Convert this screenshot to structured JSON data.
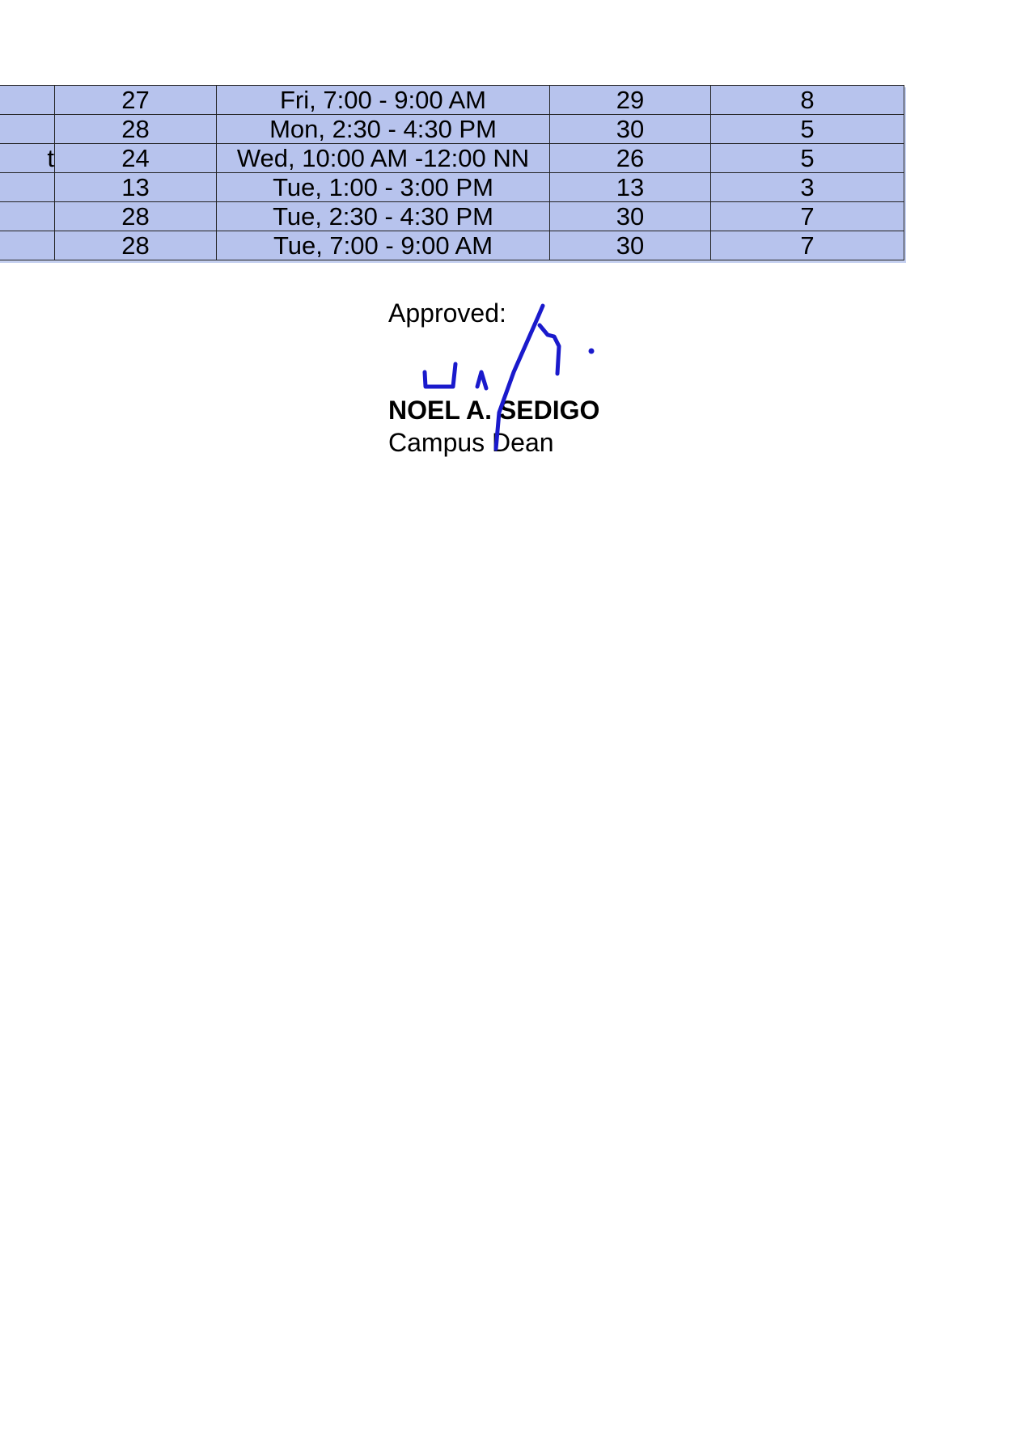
{
  "schedule": {
    "rows": [
      {
        "cells": [
          "",
          "27",
          "Fri, 7:00 - 9:00 AM",
          "29",
          "8"
        ]
      },
      {
        "cells": [
          "",
          "28",
          "Mon, 2:30 - 4:30 PM",
          "30",
          "5"
        ]
      },
      {
        "cells": [
          "t",
          "24",
          "Wed, 10:00 AM -12:00 NN",
          "26",
          "5"
        ]
      },
      {
        "cells": [
          "",
          "13",
          "Tue, 1:00 - 3:00 PM",
          "13",
          "3"
        ]
      },
      {
        "cells": [
          "",
          "28",
          "Tue, 2:30 - 4:30 PM",
          "30",
          "7"
        ]
      },
      {
        "cells": [
          "",
          "28",
          "Tue, 7:00 - 9:00 AM",
          "30",
          "7"
        ]
      }
    ],
    "row_fill_color": "#b7c3ed"
  },
  "approval": {
    "label": "Approved:",
    "name": "NOEL A. SEDIGO",
    "title": "Campus Dean",
    "signature_color": "#1a1acc"
  }
}
